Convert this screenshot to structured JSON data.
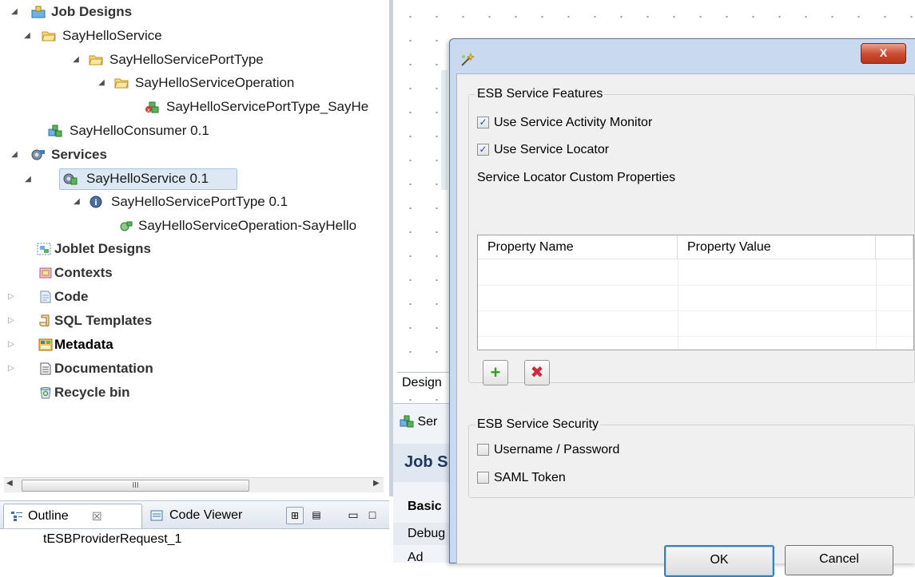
{
  "repository": {
    "job_designs": "Job Designs",
    "say_hello_service_folder": "SayHelloService",
    "port_type_folder": "SayHelloServicePortType",
    "operation_folder": "SayHelloServiceOperation",
    "job_item": "SayHelloServicePortType_SayHe",
    "consumer_job": "SayHelloConsumer 0.1",
    "services": "Services",
    "service_item": "SayHelloService 0.1",
    "port_type_item": "SayHelloServicePortType 0.1",
    "operation_item": "SayHelloServiceOperation-SayHello",
    "joblet_designs": "Joblet Designs",
    "contexts": "Contexts",
    "code": "Code",
    "sql_templates": "SQL Templates",
    "metadata": "Metadata",
    "documentation": "Documentation",
    "recycle_bin": "Recycle bin"
  },
  "scrollbar": {
    "thumb_grip": "III"
  },
  "outline": {
    "tab_outline": "Outline",
    "tab_outline_close": "☒",
    "tab_code_viewer": "Code Viewer",
    "item": "tESBProviderRequest_1"
  },
  "designer": {
    "design_tab": "Design",
    "job_tab_fragment": "Ser",
    "job_title_fragment": "Job S",
    "basic_tab": "Basic",
    "debug_tab": "Debug",
    "adv_tab": "Ad"
  },
  "dialog": {
    "close_glyph": "X",
    "esb_features_title": "ESB Service Features",
    "use_sam_label": "Use Service Activity Monitor",
    "use_sam_checked": true,
    "use_locator_label": "Use Service Locator",
    "use_locator_checked": true,
    "custom_props_label": "Service Locator Custom Properties",
    "table_headers": [
      "Property Name",
      "Property Value"
    ],
    "add_glyph": "+",
    "remove_glyph": "✖",
    "security_title": "ESB Service Security",
    "username_label": "Username / Password",
    "username_checked": false,
    "saml_label": "SAML Token",
    "saml_checked": false,
    "ok_label": "OK",
    "cancel_label": "Cancel"
  },
  "colors": {
    "folder": "#e8b54a",
    "job_green": "#3a9b3a",
    "dialog_frame": "#c9daf0",
    "close_red": "#c94a2e",
    "selection": "#dde8f5"
  }
}
